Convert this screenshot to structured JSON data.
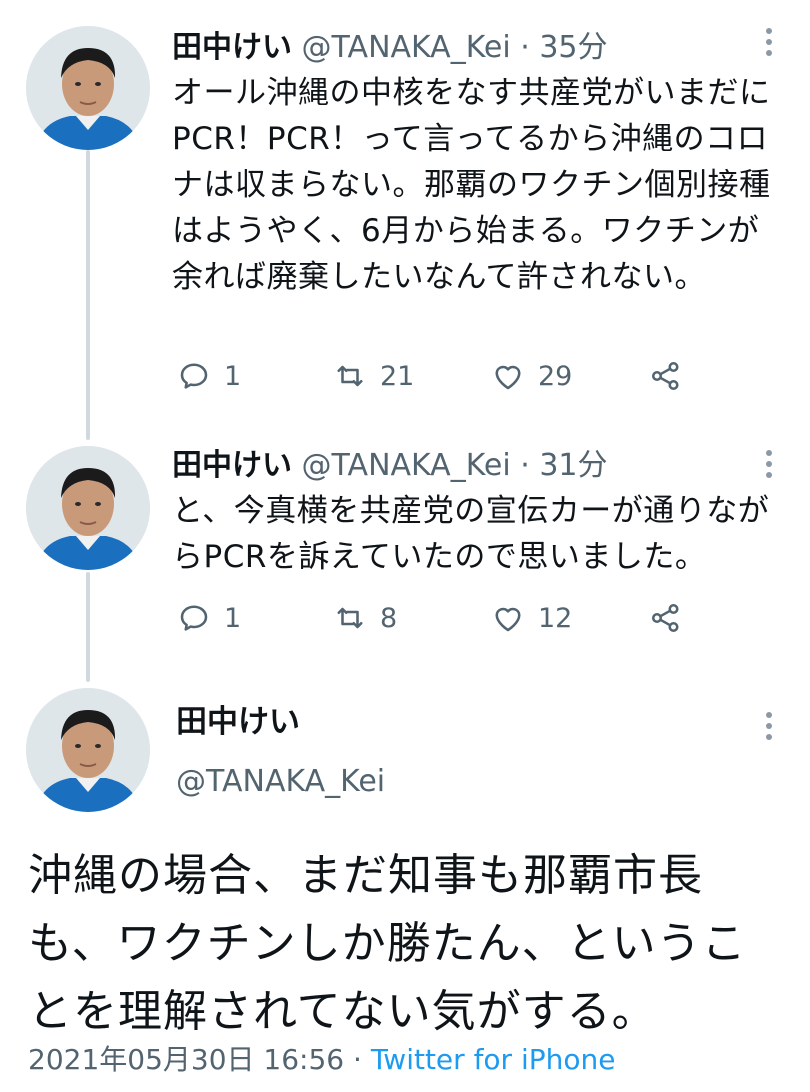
{
  "tweets": [
    {
      "name": "田中けい",
      "handle": "@TANAKA_Kei",
      "separator": "·",
      "time": "35分",
      "text": "オール沖縄の中核をなす共産党がいまだにPCR！PCR！って言ってるから沖縄のコロナは収まらない。那覇のワクチン個別接種はようやく、6月から始まる。ワクチンが余れば廃棄したいなんて許されない。",
      "replies": "1",
      "retweets": "21",
      "likes": "29"
    },
    {
      "name": "田中けい",
      "handle": "@TANAKA_Kei",
      "separator": "·",
      "time": "31分",
      "text": "と、今真横を共産党の宣伝カーが通りながらPCRを訴えていたので思いました。",
      "replies": "1",
      "retweets": "8",
      "likes": "12"
    }
  ],
  "main_tweet": {
    "name": "田中けい",
    "handle": "@TANAKA_Kei",
    "text": "沖縄の場合、まだ知事も那覇市長も、ワクチンしか勝たん、ということを理解されてない気がする。",
    "date": "2021年05月30日 16:56",
    "separator": "·",
    "source": "Twitter for iPhone"
  },
  "icons": {
    "reply": "reply-icon",
    "retweet": "retweet-icon",
    "like": "heart-icon",
    "share": "share-icon",
    "more": "more-vertical-icon"
  },
  "colors": {
    "link": "#1d9bf0",
    "secondary": "#536471",
    "thread_line": "#cfd9de"
  }
}
